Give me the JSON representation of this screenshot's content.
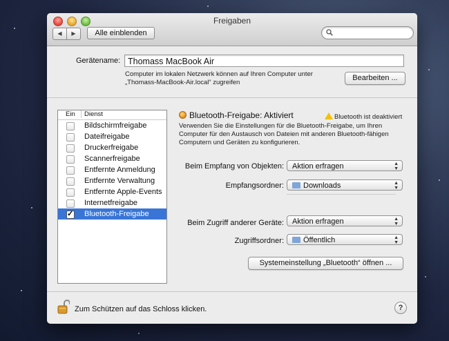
{
  "window": {
    "title": "Freigaben",
    "nav_back": "◀",
    "nav_forward": "▶",
    "show_all_label": "Alle einblenden",
    "search_placeholder": ""
  },
  "device": {
    "name_label": "Gerätename:",
    "name_value": "Thomass MacBook Air",
    "info_line1": "Computer im lokalen Netzwerk können auf Ihren Computer unter",
    "info_line2": "„Thomass-MacBook-Air.local“ zugreifen",
    "edit_button": "Bearbeiten ..."
  },
  "services": {
    "header_on": "Ein",
    "header_service": "Dienst",
    "items": [
      {
        "label": "Bildschirmfreigabe",
        "checked": false,
        "selected": false
      },
      {
        "label": "Dateifreigabe",
        "checked": false,
        "selected": false
      },
      {
        "label": "Druckerfreigabe",
        "checked": false,
        "selected": false
      },
      {
        "label": "Scannerfreigabe",
        "checked": false,
        "selected": false
      },
      {
        "label": "Entfernte Anmeldung",
        "checked": false,
        "selected": false
      },
      {
        "label": "Entfernte Verwaltung",
        "checked": false,
        "selected": false
      },
      {
        "label": "Entfernte Apple-Events",
        "checked": false,
        "selected": false
      },
      {
        "label": "Internetfreigabe",
        "checked": false,
        "selected": false
      },
      {
        "label": "Bluetooth-Freigabe",
        "checked": true,
        "selected": true
      }
    ]
  },
  "detail": {
    "status_text": "Bluetooth-Freigabe: Aktiviert",
    "warning_text": "Bluetooth ist deaktiviert",
    "description_line1": "Verwenden Sie die Einstellungen für die Bluetooth-Freigabe, um Ihren",
    "description_line2": "Computer für den Austausch von Dateien mit anderen Bluetooth-fähigen",
    "description_line3": "Computern und Geräten zu konfigurieren.",
    "receive_label": "Beim Empfang von Objekten:",
    "receive_value": "Aktion erfragen",
    "receive_folder_label": "Empfangsordner:",
    "receive_folder_value": "Downloads",
    "access_label": "Beim Zugriff anderer Geräte:",
    "access_value": "Aktion erfragen",
    "access_folder_label": "Zugriffsordner:",
    "access_folder_value": "Öffentlich",
    "bluetooth_prefs_button": "Systemeinstellung „Bluetooth“ öffnen ..."
  },
  "footer": {
    "lock_text": "Zum Schützen auf das Schloss klicken.",
    "help_label": "?"
  },
  "colors": {
    "selection": "#3875d7",
    "window_bg": "#ececec",
    "status_dot": "#e08a12"
  }
}
